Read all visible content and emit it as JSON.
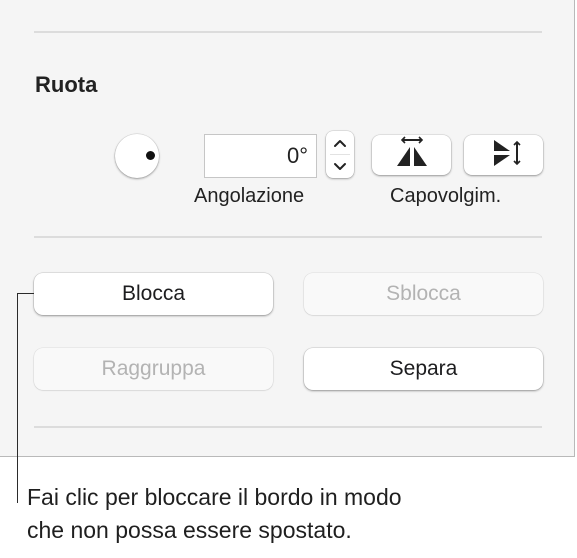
{
  "rotate_section": {
    "title": "Ruota",
    "angle_value": "0°",
    "angle_label": "Angolazione",
    "flip_label": "Capovolgim."
  },
  "icons": {
    "rotation_dial": "rotation-dial-icon",
    "stepper_up": "chevron-up-icon",
    "stepper_down": "chevron-down-icon",
    "flip_horizontal": "flip-horizontal-icon",
    "flip_vertical": "flip-vertical-icon"
  },
  "arrange_buttons": {
    "lock": "Blocca",
    "unlock": "Sblocca",
    "group": "Raggruppa",
    "ungroup": "Separa"
  },
  "button_states": {
    "lock": "enabled",
    "unlock": "disabled",
    "group": "disabled",
    "ungroup": "enabled"
  },
  "callout": {
    "line1": "Fai clic per bloccare il bordo in modo",
    "line2": "che non possa essere spostato."
  },
  "colors": {
    "panel_background": "#f5f5f5",
    "disabled_text": "#b3b3b3",
    "enabled_text": "#1d1d1f"
  }
}
